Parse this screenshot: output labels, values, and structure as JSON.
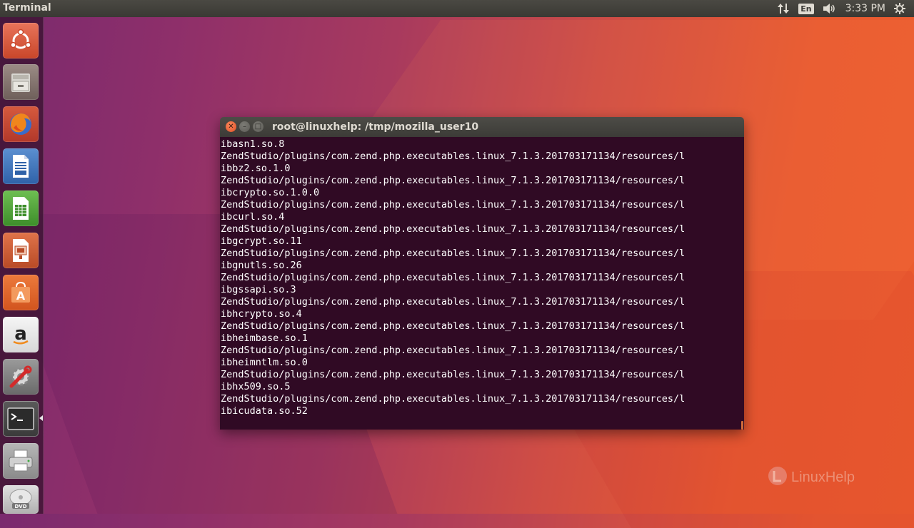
{
  "top_panel": {
    "app_title": "Terminal",
    "keyboard_layout": "En",
    "clock": "3:33 PM"
  },
  "launcher": {
    "items": [
      {
        "name": "Ubuntu Dash",
        "icon": "ubuntu-logo-icon"
      },
      {
        "name": "Files",
        "icon": "file-cabinet-icon"
      },
      {
        "name": "Firefox",
        "icon": "firefox-icon"
      },
      {
        "name": "LibreOffice Writer",
        "icon": "writer-document-icon"
      },
      {
        "name": "LibreOffice Calc",
        "icon": "calc-spreadsheet-icon"
      },
      {
        "name": "LibreOffice Impress",
        "icon": "impress-presentation-icon"
      },
      {
        "name": "Ubuntu Software",
        "icon": "software-center-bag-icon"
      },
      {
        "name": "Amazon",
        "icon": "amazon-icon"
      },
      {
        "name": "System Settings",
        "icon": "settings-wrench-icon"
      },
      {
        "name": "Terminal",
        "icon": "terminal-icon"
      },
      {
        "name": "Printer",
        "icon": "printer-icon"
      },
      {
        "name": "DVD",
        "icon": "dvd-disc-icon"
      }
    ]
  },
  "terminal": {
    "title": "root@linuxhelp: /tmp/mozilla_user10",
    "lines": [
      "ibasn1.so.8",
      "ZendStudio/plugins/com.zend.php.executables.linux_7.1.3.201703171134/resources/l",
      "ibbz2.so.1.0",
      "ZendStudio/plugins/com.zend.php.executables.linux_7.1.3.201703171134/resources/l",
      "ibcrypto.so.1.0.0",
      "ZendStudio/plugins/com.zend.php.executables.linux_7.1.3.201703171134/resources/l",
      "ibcurl.so.4",
      "ZendStudio/plugins/com.zend.php.executables.linux_7.1.3.201703171134/resources/l",
      "ibgcrypt.so.11",
      "ZendStudio/plugins/com.zend.php.executables.linux_7.1.3.201703171134/resources/l",
      "ibgnutls.so.26",
      "ZendStudio/plugins/com.zend.php.executables.linux_7.1.3.201703171134/resources/l",
      "ibgssapi.so.3",
      "ZendStudio/plugins/com.zend.php.executables.linux_7.1.3.201703171134/resources/l",
      "ibhcrypto.so.4",
      "ZendStudio/plugins/com.zend.php.executables.linux_7.1.3.201703171134/resources/l",
      "ibheimbase.so.1",
      "ZendStudio/plugins/com.zend.php.executables.linux_7.1.3.201703171134/resources/l",
      "ibheimntlm.so.0",
      "ZendStudio/plugins/com.zend.php.executables.linux_7.1.3.201703171134/resources/l",
      "ibhx509.so.5",
      "ZendStudio/plugins/com.zend.php.executables.linux_7.1.3.201703171134/resources/l",
      "ibicudata.so.52"
    ]
  },
  "watermark": {
    "text": "LinuxHelp"
  },
  "colors": {
    "terminal_bg": "#300a24",
    "panel_bg": "#3c3b37",
    "accent_orange": "#e95420"
  }
}
